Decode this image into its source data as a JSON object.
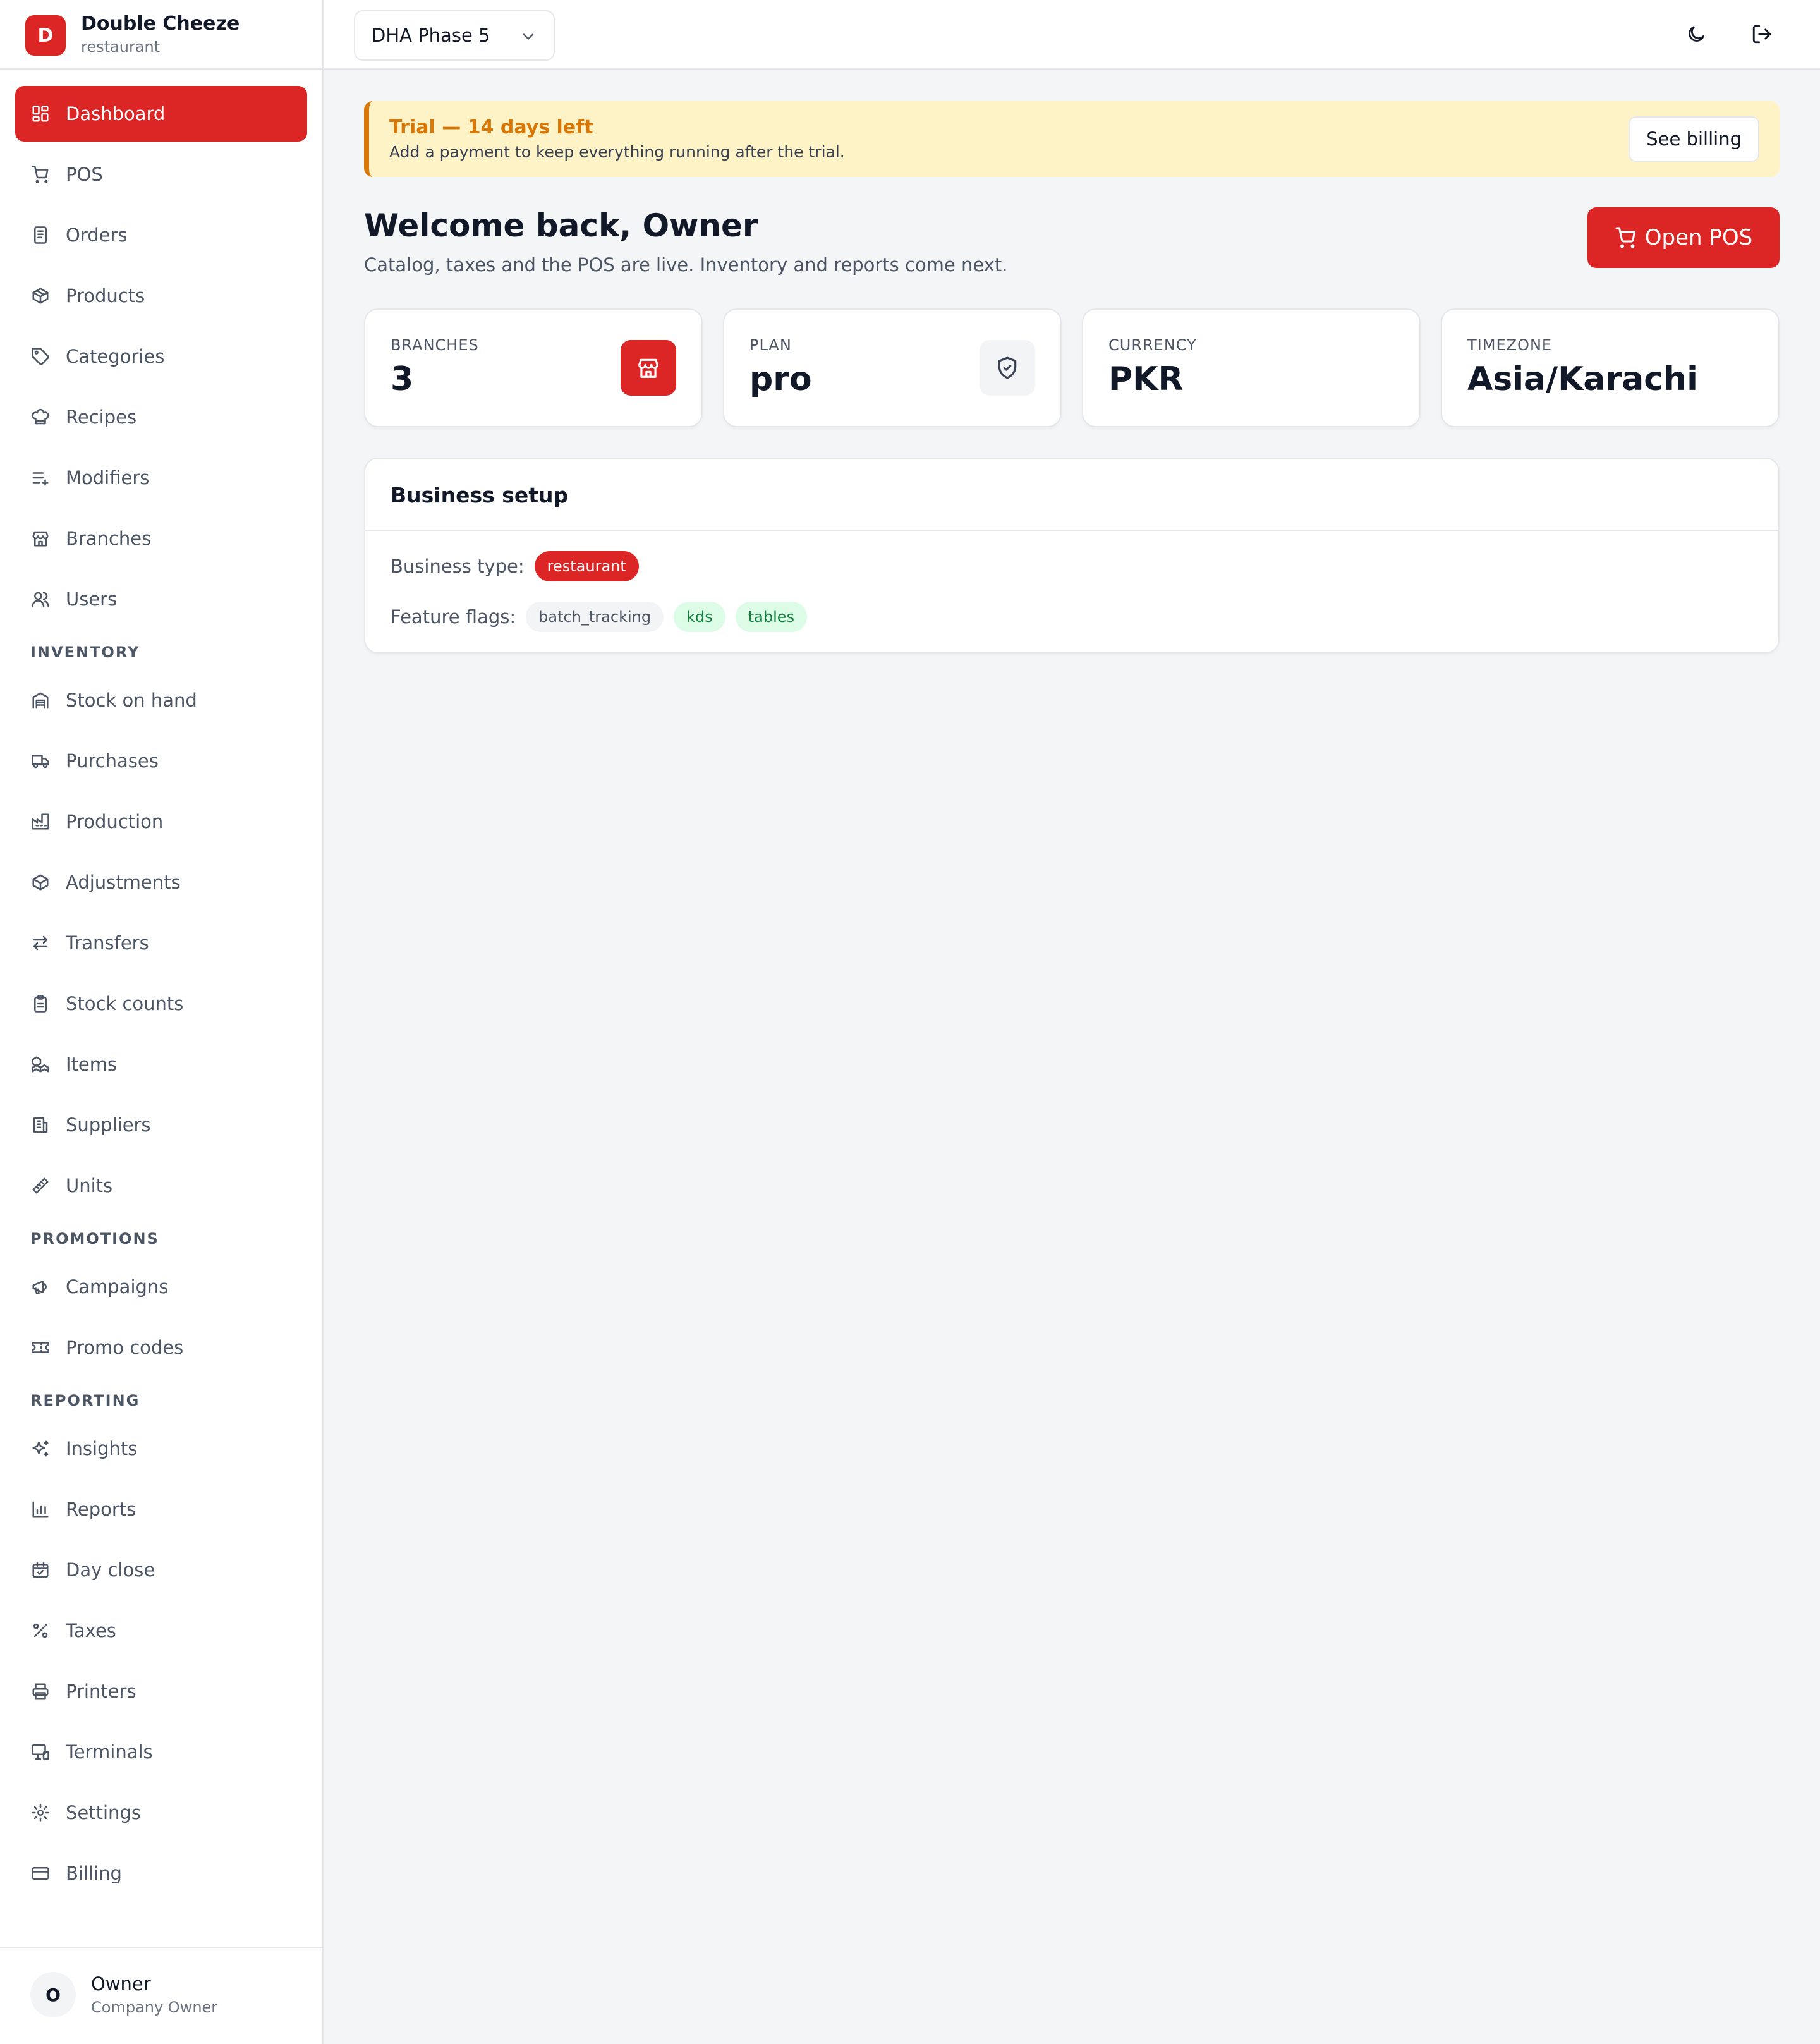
{
  "brand": {
    "logo_letter": "D",
    "name": "Double Cheeze",
    "type": "restaurant",
    "accent": "#dc2626"
  },
  "nav": {
    "main": [
      {
        "label": "Dashboard",
        "icon": "dashboard-icon",
        "active": true
      },
      {
        "label": "POS",
        "icon": "cart-icon"
      },
      {
        "label": "Orders",
        "icon": "receipt-icon"
      },
      {
        "label": "Products",
        "icon": "package-icon"
      },
      {
        "label": "Categories",
        "icon": "tag-icon"
      },
      {
        "label": "Recipes",
        "icon": "chef-hat-icon"
      },
      {
        "label": "Modifiers",
        "icon": "list-plus-icon"
      },
      {
        "label": "Branches",
        "icon": "store-icon"
      },
      {
        "label": "Users",
        "icon": "users-icon"
      }
    ],
    "inventory_heading": "INVENTORY",
    "inventory": [
      {
        "label": "Stock on hand",
        "icon": "warehouse-icon"
      },
      {
        "label": "Purchases",
        "icon": "truck-icon"
      },
      {
        "label": "Production",
        "icon": "factory-icon"
      },
      {
        "label": "Adjustments",
        "icon": "package-icon"
      },
      {
        "label": "Transfers",
        "icon": "arrows-swap-icon"
      },
      {
        "label": "Stock counts",
        "icon": "clipboard-icon"
      },
      {
        "label": "Items",
        "icon": "boxes-icon"
      },
      {
        "label": "Suppliers",
        "icon": "building-icon"
      },
      {
        "label": "Units",
        "icon": "ruler-icon"
      }
    ],
    "promotions_heading": "PROMOTIONS",
    "promotions": [
      {
        "label": "Campaigns",
        "icon": "megaphone-icon"
      },
      {
        "label": "Promo codes",
        "icon": "ticket-icon"
      }
    ],
    "reporting_heading": "REPORTING",
    "reporting": [
      {
        "label": "Insights",
        "icon": "sparkles-icon"
      },
      {
        "label": "Reports",
        "icon": "bar-chart-icon"
      },
      {
        "label": "Day close",
        "icon": "calendar-check-icon"
      },
      {
        "label": "Taxes",
        "icon": "percent-icon"
      },
      {
        "label": "Printers",
        "icon": "printer-icon"
      },
      {
        "label": "Terminals",
        "icon": "monitor-icon"
      },
      {
        "label": "Settings",
        "icon": "gear-icon"
      },
      {
        "label": "Billing",
        "icon": "credit-card-icon"
      }
    ]
  },
  "user": {
    "initial": "O",
    "name": "Owner",
    "role": "Company Owner"
  },
  "topbar": {
    "branch": "DHA Phase 5"
  },
  "trial": {
    "title": "Trial — 14 days left",
    "text": "Add a payment to keep everything running after the trial.",
    "button": "See billing"
  },
  "welcome": {
    "title": "Welcome back, Owner",
    "subtitle": "Catalog, taxes and the POS are live. Inventory and reports come next.",
    "open_pos": "Open POS"
  },
  "stats": [
    {
      "label": "BRANCHES",
      "value": "3",
      "icon": "store-icon"
    },
    {
      "label": "PLAN",
      "value": "pro",
      "icon": "shield-check-icon"
    },
    {
      "label": "CURRENCY",
      "value": "PKR"
    },
    {
      "label": "TIMEZONE",
      "value": "Asia/Karachi"
    }
  ],
  "setup": {
    "title": "Business setup",
    "type_label": "Business type:",
    "type_value": "restaurant",
    "flags_label": "Feature flags:",
    "flags": [
      "batch_tracking",
      "kds",
      "tables"
    ]
  }
}
